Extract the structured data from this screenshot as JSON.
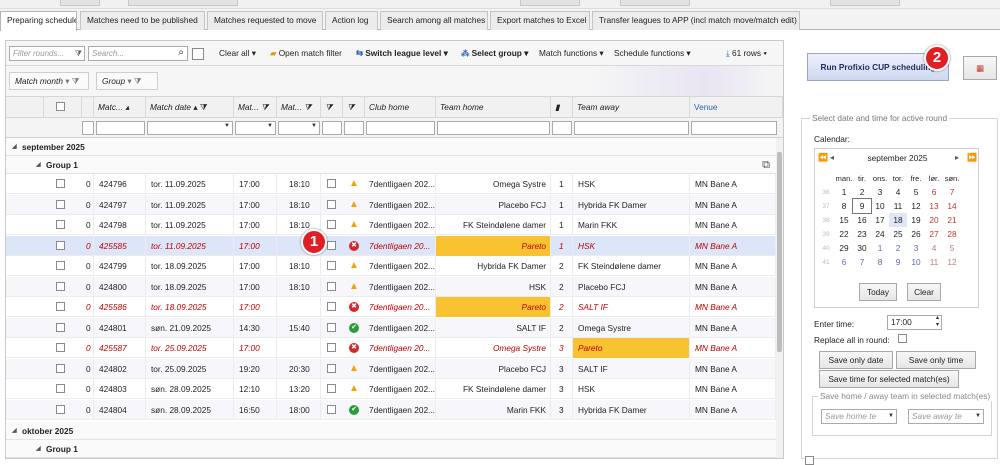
{
  "tabs": [
    "Preparing schedule",
    "Matches need to be published",
    "Matches requested to move",
    "Action log",
    "Search among all matches",
    "Export matches to Excel",
    "Transfer leagues to APP (incl match move/match edit)"
  ],
  "toolbar": {
    "filter_rounds_placeholder": "Filter rounds...",
    "search_placeholder": "Search...",
    "clear_all": "Clear all",
    "open_match_filter": "Open match filter",
    "switch_league_level": "Switch league level",
    "select_group": "Select group",
    "match_functions": "Match functions",
    "schedule_functions": "Schedule functions",
    "rows": "61 rows"
  },
  "group_area": {
    "chips": [
      "Match month",
      "Group"
    ]
  },
  "columns": [
    "Matc...",
    "Match date",
    "Mat...",
    "Mat...",
    "Club home",
    "Team home",
    "Team away",
    "Venue"
  ],
  "groups": {
    "sep": "september 2025",
    "sep_group": "Group 1",
    "oct": "oktober 2025",
    "oct_group": "Group 1"
  },
  "rows": [
    {
      "n": "0",
      "id": "424796",
      "date": "tor. 11.09.2025",
      "t1": "17:00",
      "t2": "18:10",
      "status": "warn",
      "club": "7dentligaen 202...",
      "home": "Omega Systre",
      "r": "1",
      "away": "HSK",
      "venue": "MN Bane A"
    },
    {
      "n": "0",
      "id": "424797",
      "date": "tor. 11.09.2025",
      "t1": "17:00",
      "t2": "18:10",
      "status": "warn",
      "club": "7dentligaen 202...",
      "home": "Placebo FCJ",
      "r": "1",
      "away": "Hybrida FK Damer",
      "venue": "MN Bane A"
    },
    {
      "n": "0",
      "id": "424798",
      "date": "tor. 11.09.2025",
      "t1": "17:00",
      "t2": "18:10",
      "status": "warn",
      "club": "7dentligaen 202...",
      "home": "FK Steindølene damer",
      "r": "1",
      "away": "Marin FKK",
      "venue": "MN Bane A"
    },
    {
      "n": "0",
      "id": "425585",
      "date": "tor. 11.09.2025",
      "t1": "17:00",
      "t2": "",
      "status": "err",
      "club": "7dentligaen 20...",
      "home": "Pareto",
      "r": "1",
      "away": "HSK",
      "venue": "MN Bane A"
    },
    {
      "n": "0",
      "id": "424799",
      "date": "tor. 18.09.2025",
      "t1": "17:00",
      "t2": "18:10",
      "status": "warn",
      "club": "7dentligaen 202...",
      "home": "Hybrida FK Damer",
      "r": "2",
      "away": "FK Steindølene damer",
      "venue": "MN Bane A"
    },
    {
      "n": "0",
      "id": "424800",
      "date": "tor. 18.09.2025",
      "t1": "17:00",
      "t2": "18:10",
      "status": "warn",
      "club": "7dentligaen 202...",
      "home": "HSK",
      "r": "2",
      "away": "Placebo FCJ",
      "venue": "MN Bane A"
    },
    {
      "n": "0",
      "id": "425586",
      "date": "tor. 18.09.2025",
      "t1": "17:00",
      "t2": "",
      "status": "err",
      "club": "7dentligaen 20...",
      "home": "Pareto",
      "r": "2",
      "away": "SALT IF",
      "venue": "MN Bane A"
    },
    {
      "n": "0",
      "id": "424801",
      "date": "søn. 21.09.2025",
      "t1": "14:30",
      "t2": "15:40",
      "status": "ok",
      "club": "7dentligaen 202...",
      "home": "SALT IF",
      "r": "2",
      "away": "Omega Systre",
      "venue": "MN Bane A"
    },
    {
      "n": "0",
      "id": "425587",
      "date": "tor. 25.09.2025",
      "t1": "17:00",
      "t2": "",
      "status": "err",
      "club": "7dentligaen 20...",
      "home": "Omega Systre",
      "r": "3",
      "away": "Pareto",
      "venue": "MN Bane A"
    },
    {
      "n": "0",
      "id": "424802",
      "date": "tor. 25.09.2025",
      "t1": "19:20",
      "t2": "20:30",
      "status": "warn",
      "club": "7dentligaen 202...",
      "home": "Placebo FCJ",
      "r": "3",
      "away": "SALT IF",
      "venue": "MN Bane A"
    },
    {
      "n": "0",
      "id": "424803",
      "date": "søn. 28.09.2025",
      "t1": "12:10",
      "t2": "13:20",
      "status": "warn",
      "club": "7dentligaen 202...",
      "home": "FK Steindølene damer",
      "r": "3",
      "away": "HSK",
      "venue": "MN Bane A"
    },
    {
      "n": "0",
      "id": "424804",
      "date": "søn. 28.09.2025",
      "t1": "16:50",
      "t2": "18:00",
      "status": "ok",
      "club": "7dentligaen 202...",
      "home": "Marin FKK",
      "r": "3",
      "away": "Hybrida FK Damer",
      "venue": "MN Bane A"
    }
  ],
  "right": {
    "run_cup": "Run Profixio CUP scheduling",
    "section_title": "Select date and time for active round",
    "calendar_label": "Calendar:",
    "month": "september 2025",
    "weekdays": [
      "man.",
      "tir.",
      "ons.",
      "tor.",
      "fre.",
      "lør.",
      "søn."
    ],
    "weeks": [
      {
        "wk": "36",
        "days": [
          "1",
          "2",
          "3",
          "4",
          "5",
          "6",
          "7"
        ]
      },
      {
        "wk": "37",
        "days": [
          "8",
          "9",
          "10",
          "11",
          "12",
          "13",
          "14"
        ]
      },
      {
        "wk": "38",
        "days": [
          "15",
          "16",
          "17",
          "18",
          "19",
          "20",
          "21"
        ]
      },
      {
        "wk": "39",
        "days": [
          "22",
          "23",
          "24",
          "25",
          "26",
          "27",
          "28"
        ]
      },
      {
        "wk": "40",
        "days": [
          "29",
          "30",
          "1",
          "2",
          "3",
          "4",
          "5"
        ]
      },
      {
        "wk": "41",
        "days": [
          "6",
          "7",
          "8",
          "9",
          "10",
          "11",
          "12"
        ]
      }
    ],
    "today": "Today",
    "clear": "Clear",
    "enter_time_label": "Enter time:",
    "time_value": "17:00",
    "replace_all_label": "Replace all in round:",
    "save_only_date": "Save only date",
    "save_only_time": "Save only time",
    "save_time_selected": "Save time for selected match(es)",
    "save_home_away_title": "Save home / away team in selected match(es)",
    "save_home_placeholder": "Save home te",
    "save_away_placeholder": "Save away te"
  },
  "annotations": {
    "badge1": "1",
    "badge2": "2"
  },
  "colors": {
    "highlight": "#f8c231",
    "error": "#d9262b",
    "warning": "#f0a30a",
    "ok": "#2a9d3a"
  }
}
